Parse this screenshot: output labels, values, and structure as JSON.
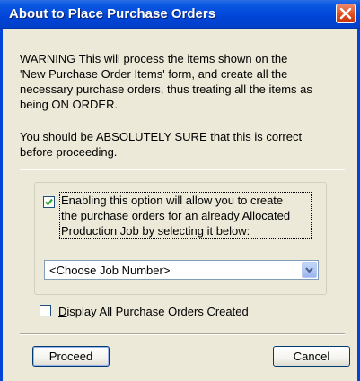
{
  "window": {
    "title": "About to Place Purchase Orders",
    "close_icon": "close-icon"
  },
  "message": {
    "warning_lines": [
      "WARNING This will process the items shown on the",
      "'New Purchase Order Items' form, and create all the",
      "necessary purchase orders, thus treating all the items as",
      "being ON ORDER."
    ],
    "sure_lines": [
      "You should be ABSOLUTELY SURE that this is correct",
      "before proceeding."
    ]
  },
  "allocated_option": {
    "checked": true,
    "label_lines": [
      "Enabling this option will allow you to create",
      "the purchase orders for an already Allocated",
      "Production Job by selecting it below:"
    ]
  },
  "job_select": {
    "value": "<Choose Job Number>",
    "icon": "chevron-down-icon"
  },
  "display_option": {
    "checked": false,
    "label": "Display All Purchase Orders Created"
  },
  "buttons": {
    "proceed": "Proceed",
    "cancel": "Cancel"
  },
  "colors": {
    "titlebar": "#0045d8",
    "dialog_bg": "#ece9d8",
    "close_button": "#e04d1f"
  }
}
